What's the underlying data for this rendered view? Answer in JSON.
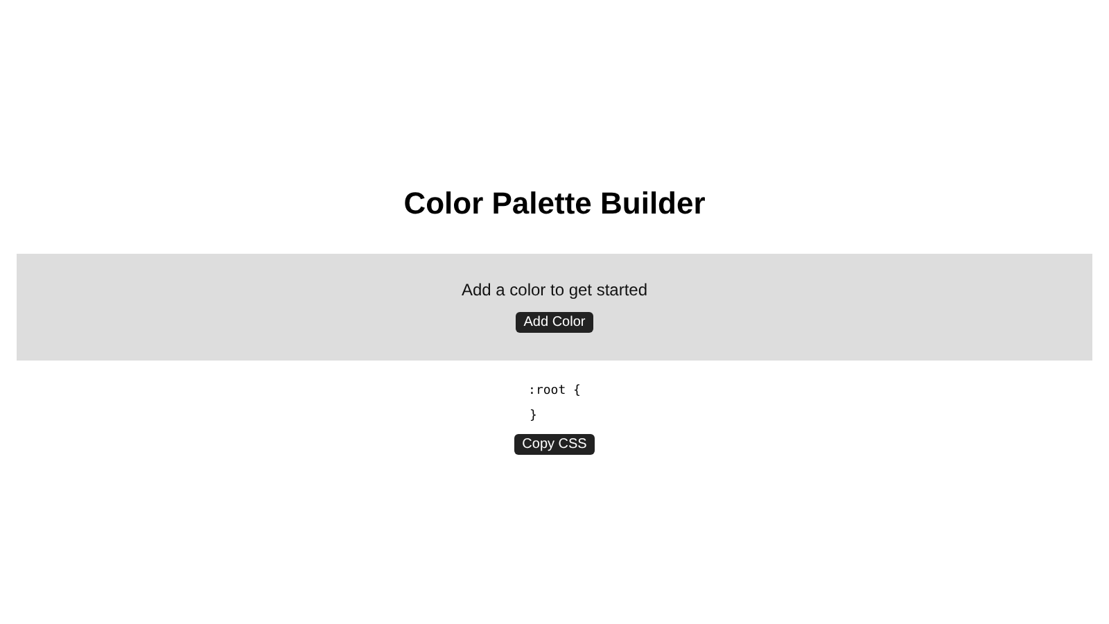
{
  "title": "Color Palette Builder",
  "palette": {
    "empty_message": "Add a color to get started",
    "add_button": "Add Color"
  },
  "css_output": {
    "lines": [
      ":root {",
      "}"
    ],
    "copy_button": "Copy CSS"
  }
}
